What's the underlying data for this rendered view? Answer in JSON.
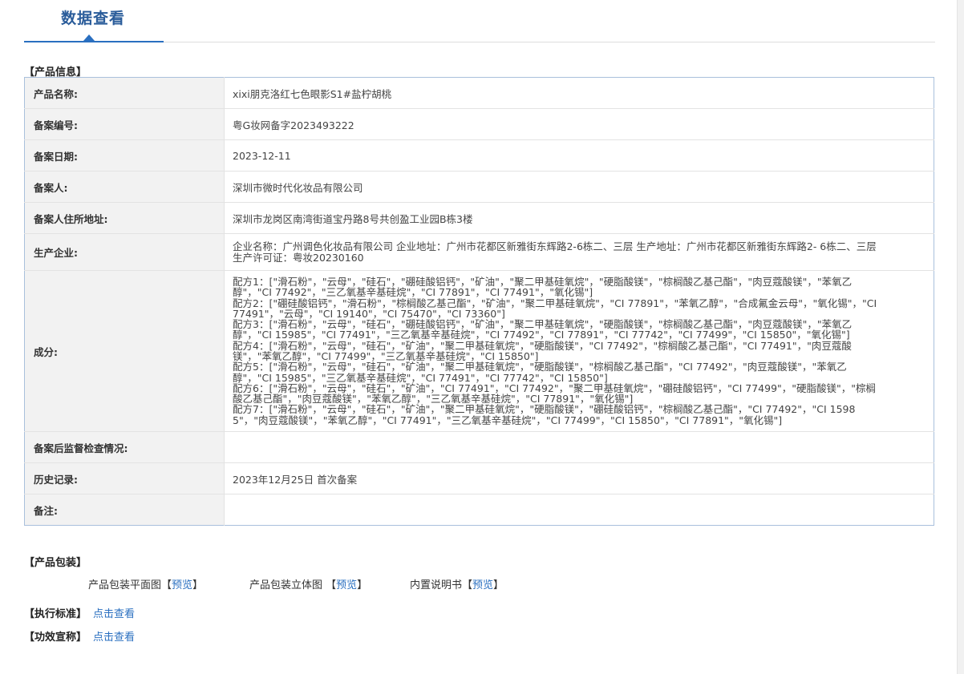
{
  "header": {
    "tab_title": "数据查看"
  },
  "product_info": {
    "section_title": "【产品信息】",
    "rows": {
      "name": {
        "label": "产品名称:",
        "value": "xixi朋克洛红七色眼影S1#盐柠胡桃"
      },
      "record_no": {
        "label": "备案编号:",
        "value": "粤G妆网备字2023493222"
      },
      "record_date": {
        "label": "备案日期:",
        "value": "2023-12-11"
      },
      "registrant": {
        "label": "备案人:",
        "value": "深圳市微时代化妆品有限公司"
      },
      "address": {
        "label": "备案人住所地址:",
        "value": "深圳市龙岗区南湾街道宝丹路8号共创盈工业园B栋3楼"
      },
      "manufacturer": {
        "label": "生产企业:",
        "value": "企业名称：广州调色化妆品有限公司 企业地址：广州市花都区新雅街东辉路2-6栋二、三层 生产地址：广州市花都区新雅街东辉路2- 6栋二、三层 生产许可证：粤妆20230160"
      },
      "ingredients": {
        "label": "成分:",
        "formulas": [
          "配方1：[\"滑石粉\"，\"云母\"，\"硅石\"，\"硼硅酸铝钙\"，\"矿油\"，\"聚二甲基硅氧烷\"，\"硬脂酸镁\"，\"棕榈酸乙基己酯\"，\"肉豆蔻酸镁\"，\"苯氧乙醇\"，\"CI 77492\"，\"三乙氧基辛基硅烷\"，\"CI 77891\"，\"CI 77491\"，\"氧化锡\"]",
          "配方2：[\"硼硅酸铝钙\"，\"滑石粉\"，\"棕榈酸乙基己酯\"，\"矿油\"，\"聚二甲基硅氧烷\"，\"CI 77891\"，\"苯氧乙醇\"，\"合成氟金云母\"，\"氧化锡\"，\"CI 77491\"，\"云母\"，\"CI 19140\"，\"CI 75470\"，\"CI 73360\"]",
          "配方3：[\"滑石粉\"，\"云母\"，\"硅石\"，\"硼硅酸铝钙\"，\"矿油\"，\"聚二甲基硅氧烷\"，\"硬脂酸镁\"，\"棕榈酸乙基己酯\"，\"肉豆蔻酸镁\"，\"苯氧乙醇\"，\"CI 15985\"，\"CI 77491\"，\"三乙氧基辛基硅烷\"，\"CI 77492\"，\"CI 77891\"，\"CI 77742\"，\"CI 77499\"，\"CI 15850\"，\"氧化锡\"]",
          "配方4：[\"滑石粉\"，\"云母\"，\"硅石\"，\"矿油\"，\"聚二甲基硅氧烷\"，\"硬脂酸镁\"，\"CI 77492\"，\"棕榈酸乙基己酯\"，\"CI 77491\"，\"肉豆蔻酸镁\"，\"苯氧乙醇\"，\"CI 77499\"，\"三乙氧基辛基硅烷\"，\"CI 15850\"]",
          "配方5：[\"滑石粉\"，\"云母\"，\"硅石\"，\"矿油\"，\"聚二甲基硅氧烷\"，\"硬脂酸镁\"，\"棕榈酸乙基己酯\"，\"CI 77492\"，\"肉豆蔻酸镁\"，\"苯氧乙醇\"，\"CI 15985\"，\"三乙氧基辛基硅烷\"，\"CI 77491\"，\"CI 77742\"，\"CI 15850\"]",
          "配方6：[\"滑石粉\"，\"云母\"，\"硅石\"，\"矿油\"，\"CI 77491\"，\"CI 77492\"，\"聚二甲基硅氧烷\"，\"硼硅酸铝钙\"，\"CI 77499\"，\"硬脂酸镁\"，\"棕榈酸乙基己酯\"，\"肉豆蔻酸镁\"，\"苯氧乙醇\"，\"三乙氧基辛基硅烷\"，\"CI 77891\"，\"氧化锡\"]",
          "配方7：[\"滑石粉\"，\"云母\"，\"硅石\"，\"矿油\"，\"聚二甲基硅氧烷\"，\"硬脂酸镁\"，\"硼硅酸铝钙\"，\"棕榈酸乙基己酯\"，\"CI 77492\"，\"CI 15985\"，\"肉豆蔻酸镁\"，\"苯氧乙醇\"，\"CI 77491\"，\"三乙氧基辛基硅烷\"，\"CI 77499\"，\"CI 15850\"，\"CI 77891\"，\"氧化锡\"]"
        ]
      },
      "supervision": {
        "label": "备案后监督检查情况:",
        "value": ""
      },
      "history": {
        "label": "历史记录:",
        "value": "2023年12月25日 首次备案"
      },
      "remarks": {
        "label": "备注:",
        "value": ""
      }
    }
  },
  "packaging": {
    "section_title": "【产品包装】",
    "items": [
      {
        "label": "产品包装平面图",
        "link": "预览"
      },
      {
        "label": "产品包装立体图",
        "link": "预览"
      },
      {
        "label": "内置说明书",
        "link": "预览"
      }
    ]
  },
  "standard": {
    "label": "【执行标准】",
    "link": "点击查看"
  },
  "efficacy": {
    "label": "【功效宣称】",
    "link": "点击查看"
  },
  "colors": {
    "accent": "#2a6fc0",
    "title": "#2a5c9a",
    "label_bg": "#f2f2f2",
    "table_border": "#a9c0dc"
  }
}
